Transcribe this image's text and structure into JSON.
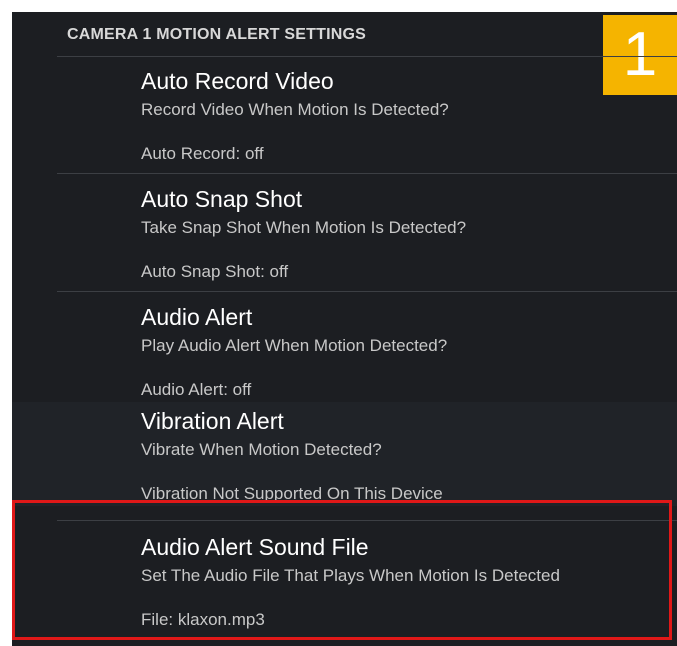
{
  "header": {
    "title": "CAMERA 1 MOTION ALERT SETTINGS",
    "badge_number": "1"
  },
  "settings": [
    {
      "title": "Auto Record Video",
      "description": "Record Video When Motion Is Detected?",
      "status": "Auto Record: off"
    },
    {
      "title": "Auto Snap Shot",
      "description": "Take Snap Shot When Motion Is Detected?",
      "status": "Auto Snap Shot: off"
    },
    {
      "title": "Audio Alert",
      "description": "Play Audio Alert When Motion Detected?",
      "status": "Audio Alert: off"
    },
    {
      "title": "Vibration Alert",
      "description": "Vibrate When Motion Detected?",
      "status": "Vibration Not Supported On This Device"
    },
    {
      "title": "Audio Alert Sound File",
      "description": "Set The Audio File That Plays When Motion Is Detected",
      "status": "File: klaxon.mp3"
    }
  ],
  "colors": {
    "background": "#1c1e22",
    "badge": "#f5b400",
    "highlight": "#e01818"
  }
}
